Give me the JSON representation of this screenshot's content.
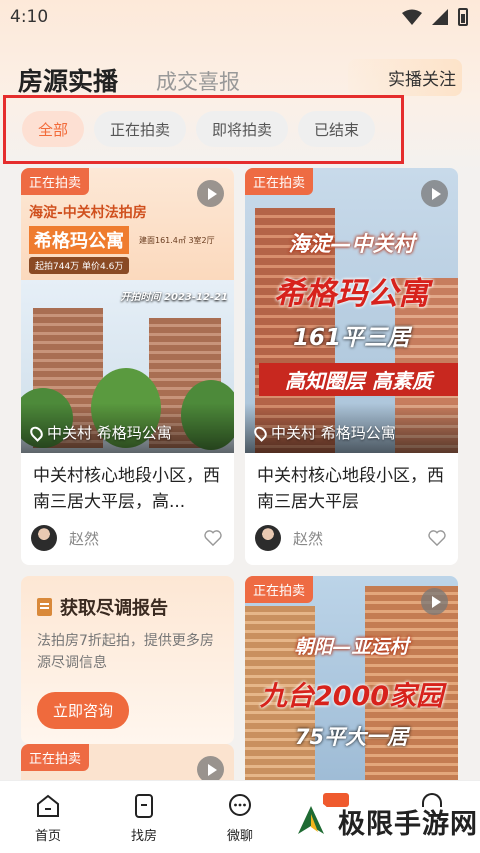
{
  "status": {
    "time": "4:10"
  },
  "header": {
    "tab_main": "房源实播",
    "tab_sub": "成交喜报",
    "follow": "实播关注"
  },
  "filters": [
    "全部",
    "正在拍卖",
    "即将拍卖",
    "已结束"
  ],
  "cards": [
    {
      "tag": "正在拍卖",
      "poster_area": "海淀-中关村法拍房",
      "poster_name": "希格玛公寓",
      "poster_size": "建面161.4㎡ 3室2厅",
      "poster_price": "起拍744万 单价4.6万",
      "poster_date": "开拍时间 2023-12-21",
      "location": "中关村  希格玛公寓",
      "title": "中关村核心地段小区，西南三居大平层，高...",
      "author": "赵然"
    },
    {
      "tag": "正在拍卖",
      "poster_line1": "海淀—中关村",
      "poster_line2": "希格玛公寓",
      "poster_line3": "161平三居",
      "poster_line4": "高知圈层 高素质",
      "location": "中关村  希格玛公寓",
      "title": "中关村核心地段小区，西南三居大平层",
      "author": "赵然"
    },
    {
      "tag": "正在拍卖",
      "poster_line1": "朝阳—亚运村",
      "poster_line2": "九台2000家园",
      "poster_line3": "75平大一居"
    },
    {
      "tag": "正在拍卖"
    }
  ],
  "report": {
    "title": "获取尽调报告",
    "text": "法拍房7折起拍，提供更多房源尽调信息",
    "button": "立即咨询"
  },
  "nav": [
    "首页",
    "找房",
    "微聊"
  ],
  "watermark": "极限手游网"
}
